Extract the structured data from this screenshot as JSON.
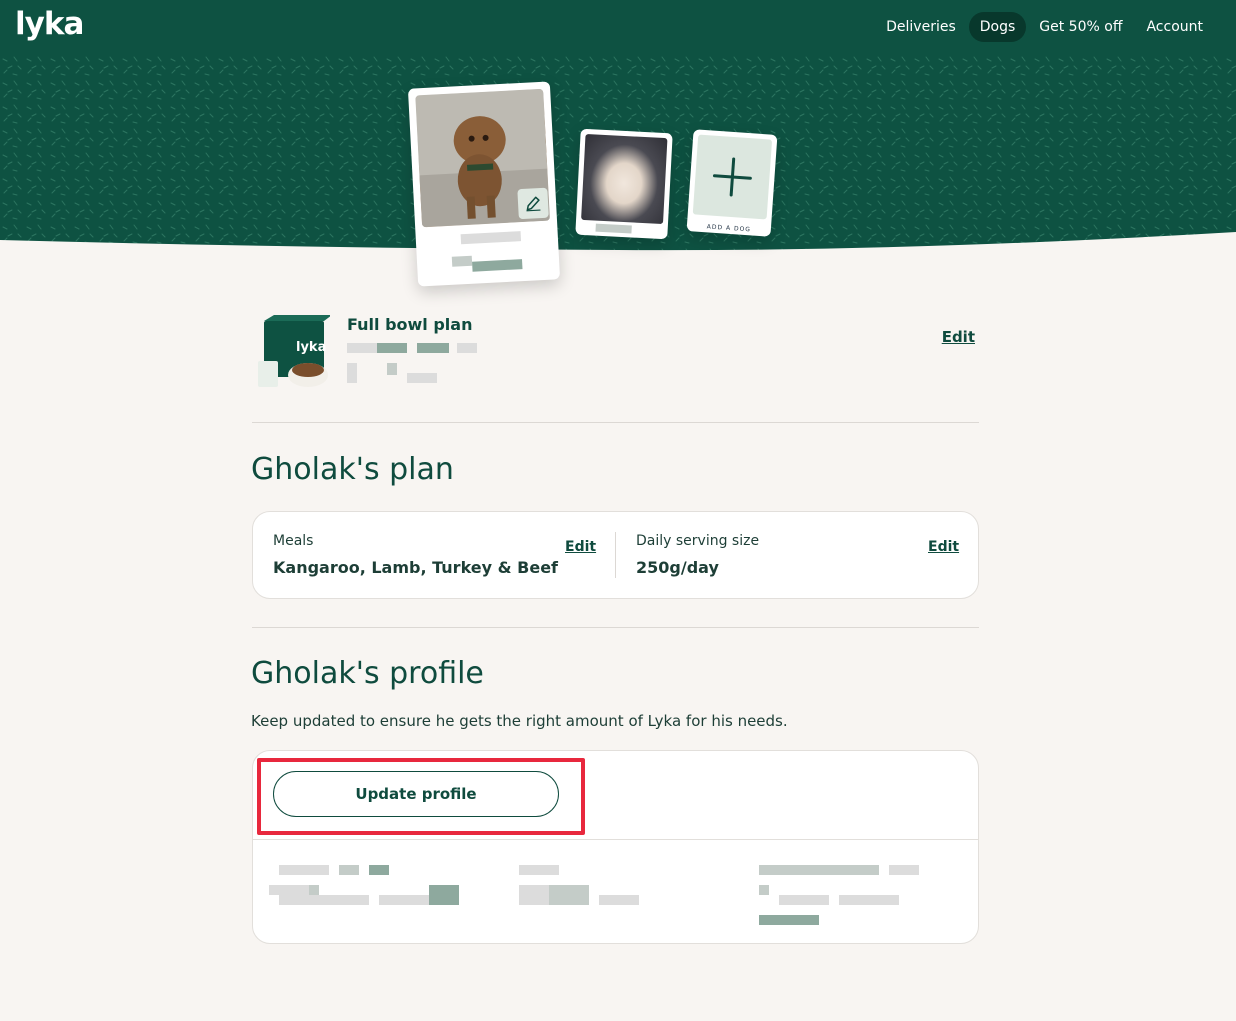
{
  "nav": {
    "logo": "lyka",
    "links": [
      {
        "label": "Deliveries",
        "active": false
      },
      {
        "label": "Dogs",
        "active": true
      },
      {
        "label": "Get 50% off",
        "active": false
      },
      {
        "label": "Account",
        "active": false
      }
    ]
  },
  "hero": {
    "add_dog_label": "ADD A DOG"
  },
  "plan_summary": {
    "title": "Full bowl plan",
    "edit_label": "Edit"
  },
  "plan": {
    "heading": "Gholak's plan",
    "meals_label": "Meals",
    "meals_value": "Kangaroo, Lamb, Turkey & Beef",
    "meals_edit": "Edit",
    "serving_label": "Daily serving size",
    "serving_value": "250g/day",
    "serving_edit": "Edit"
  },
  "profile": {
    "heading": "Gholak's profile",
    "subtitle": "Keep updated to ensure he gets the right amount of Lyka for his needs.",
    "update_button": "Update profile"
  },
  "colors": {
    "brand_green": "#0e5242",
    "nav_active": "#08382c",
    "background": "#f8f5f2",
    "highlight": "#e8283d"
  }
}
